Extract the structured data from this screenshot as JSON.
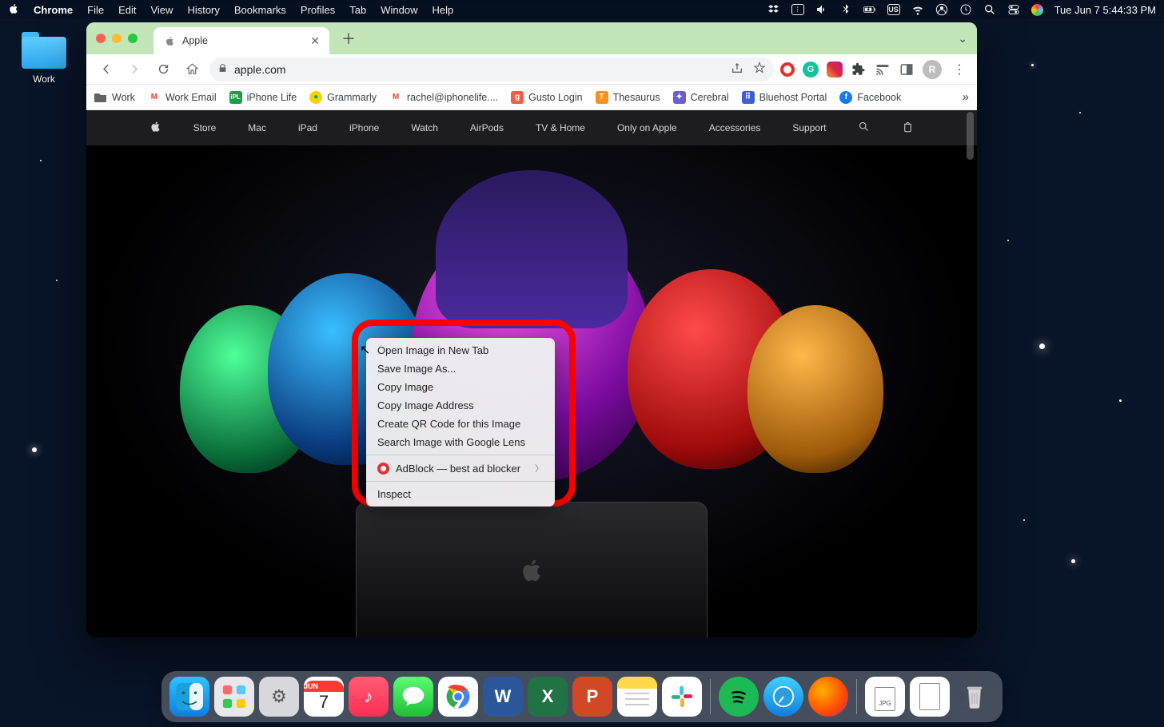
{
  "menubar": {
    "app": "Chrome",
    "items": [
      "File",
      "Edit",
      "View",
      "History",
      "Bookmarks",
      "Profiles",
      "Tab",
      "Window",
      "Help"
    ],
    "datetime": "Tue Jun 7  5:44:33 PM",
    "input_badge": "US"
  },
  "desktop": {
    "folder_label": "Work"
  },
  "chrome": {
    "tab": {
      "title": "Apple"
    },
    "url": "apple.com",
    "avatar_initial": "R",
    "bookmarks": [
      {
        "label": "Work",
        "icon": "folder",
        "bg": "#5f6368",
        "fg": "#fff",
        "txt": ""
      },
      {
        "label": "Work Email",
        "icon": "M",
        "bg": "#fff",
        "fg": "#ea4335",
        "txt": "M"
      },
      {
        "label": "iPhone Life",
        "icon": "ipl",
        "bg": "#1a9e4a",
        "fg": "#fff",
        "txt": "iP"
      },
      {
        "label": "Grammarly",
        "icon": "g",
        "bg": "#ffd000",
        "fg": "#0a4",
        "txt": "●"
      },
      {
        "label": "rachel@iphonelife....",
        "icon": "M",
        "bg": "#fff",
        "fg": "#ea4335",
        "txt": "M"
      },
      {
        "label": "Gusto Login",
        "icon": "g",
        "bg": "#f45d48",
        "fg": "#fff",
        "txt": "g"
      },
      {
        "label": "Thesaurus",
        "icon": "T",
        "bg": "#f6921e",
        "fg": "#fff",
        "txt": "T"
      },
      {
        "label": "Cerebral",
        "icon": "C",
        "bg": "#6b5dd3",
        "fg": "#fff",
        "txt": "✦"
      },
      {
        "label": "Bluehost Portal",
        "icon": "bh",
        "bg": "#3b5fcc",
        "fg": "#fff",
        "txt": "⠿"
      },
      {
        "label": "Facebook",
        "icon": "f",
        "bg": "#1877f2",
        "fg": "#fff",
        "txt": "f"
      }
    ]
  },
  "apple_nav": [
    "Store",
    "Mac",
    "iPad",
    "iPhone",
    "Watch",
    "AirPods",
    "TV & Home",
    "Only on Apple",
    "Accessories",
    "Support"
  ],
  "context_menu": {
    "items_a": [
      "Open Image in New Tab",
      "Save Image As...",
      "Copy Image",
      "Copy Image Address",
      "Create QR Code for this Image",
      "Search Image with Google Lens"
    ],
    "adblock": "AdBlock — best ad blocker",
    "inspect": "Inspect"
  },
  "dock": {
    "apps": [
      {
        "name": "finder",
        "bg": "linear-gradient(#29c4ff,#0f7de0)",
        "glyph": "☺"
      },
      {
        "name": "launchpad",
        "bg": "#e8e8ec",
        "glyph": "⊞"
      },
      {
        "name": "settings",
        "bg": "#d8d8dc",
        "glyph": "⚙"
      },
      {
        "name": "calendar",
        "bg": "#fff",
        "glyph": "cal"
      },
      {
        "name": "music",
        "bg": "linear-gradient(#ff5c74,#ff2d55)",
        "glyph": "♪"
      },
      {
        "name": "messages",
        "bg": "linear-gradient(#5dfb73,#1fbf3a)",
        "glyph": "💬"
      },
      {
        "name": "chrome",
        "bg": "#fff",
        "glyph": "chrome"
      },
      {
        "name": "word",
        "bg": "#2b579a",
        "glyph": "W"
      },
      {
        "name": "excel",
        "bg": "#217346",
        "glyph": "X"
      },
      {
        "name": "powerpoint",
        "bg": "#d24726",
        "glyph": "P"
      },
      {
        "name": "notes",
        "bg": "linear-gradient(#fff 50%,#ffd94a 50%)",
        "glyph": ""
      },
      {
        "name": "slack",
        "bg": "#fff",
        "glyph": "✱"
      },
      {
        "name": "spotify",
        "bg": "#1db954",
        "glyph": "♫"
      },
      {
        "name": "safari",
        "bg": "linear-gradient(#3fd0ff,#0f7de0)",
        "glyph": "✦"
      },
      {
        "name": "firefox",
        "bg": "radial-gradient(circle,#ffb000,#ff4a00 70%,#a22 100%)",
        "glyph": ""
      }
    ],
    "right": [
      {
        "name": "download-jpg",
        "bg": "#fff",
        "glyph": "JPG"
      },
      {
        "name": "download-file",
        "bg": "#fff",
        "glyph": "▮"
      },
      {
        "name": "trash",
        "bg": "transparent",
        "glyph": "🗑"
      }
    ],
    "cal_month": "JUN",
    "cal_day": "7"
  }
}
